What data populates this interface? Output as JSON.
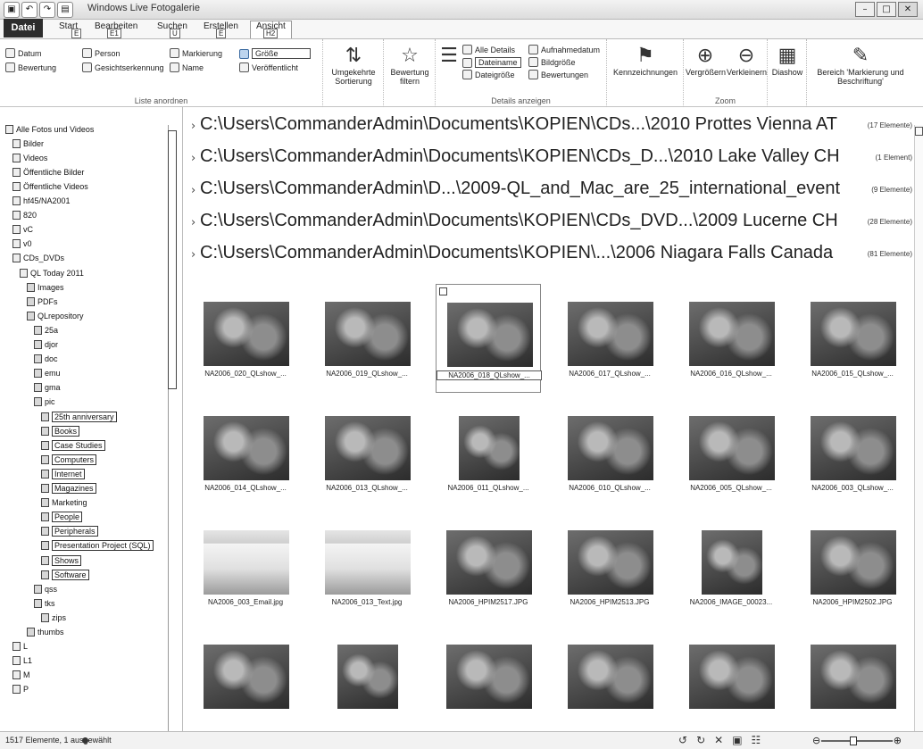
{
  "window": {
    "title": "Windows Live Fotogalerie"
  },
  "ribbon": {
    "app_menu": "Datei",
    "tabs": [
      {
        "label": "Start",
        "key": "E"
      },
      {
        "label": "Bearbeiten",
        "key": "E1"
      },
      {
        "label": "Suchen",
        "key": "U"
      },
      {
        "label": "Erstellen",
        "key": "E"
      },
      {
        "label": "Ansicht",
        "key": "H2"
      }
    ],
    "groups": {
      "list_arrange": {
        "label": "Liste anordnen",
        "items": [
          "Datum",
          "Bewertung",
          "Person",
          "Gesichtserkennung",
          "Markierung",
          "Name",
          "Größe",
          "Veröffentlicht"
        ]
      },
      "sort": {
        "label": "Umgekehrte Sortierung"
      },
      "rating": {
        "label": "Bewertung filtern"
      },
      "details": {
        "label": "Details anzeigen",
        "items": [
          "Alle Details",
          "Aufnahmedatum",
          "Dateiname",
          "Bildgröße",
          "Dateigröße",
          "Bewertungen"
        ]
      },
      "tags": {
        "label": "Kennzeichnungen"
      },
      "zoom": {
        "label": "Zoom",
        "items": [
          "Vergrößern",
          "Verkleinern"
        ]
      },
      "slideshow": {
        "label": "Diashow"
      },
      "view_toggle": {
        "label": "Bereich 'Markierung und Beschriftung'"
      }
    }
  },
  "sidebar": {
    "items": [
      {
        "label": "Alle Fotos und Videos",
        "indent": 0
      },
      {
        "label": "Bilder",
        "indent": 1
      },
      {
        "label": "Videos",
        "indent": 1
      },
      {
        "label": "Öffentliche Bilder",
        "indent": 1
      },
      {
        "label": "Öffentliche Videos",
        "indent": 1
      },
      {
        "label": "hf45/NA2001",
        "indent": 1
      },
      {
        "label": "820",
        "indent": 1
      },
      {
        "label": "vC",
        "indent": 1
      },
      {
        "label": "v0",
        "indent": 1
      },
      {
        "label": "CDs_DVDs",
        "indent": 1
      },
      {
        "label": "QL Today 2011",
        "indent": 2
      },
      {
        "label": "Images",
        "indent": 3
      },
      {
        "label": "PDFs",
        "indent": 3
      },
      {
        "label": "QLrepository",
        "indent": 3
      },
      {
        "label": "25a",
        "indent": 4
      },
      {
        "label": "djor",
        "indent": 4
      },
      {
        "label": "doc",
        "indent": 4
      },
      {
        "label": "emu",
        "indent": 4
      },
      {
        "label": "gma",
        "indent": 4
      },
      {
        "label": "pic",
        "indent": 4
      },
      {
        "label": "25th anniversary",
        "indent": 5,
        "boxed": true
      },
      {
        "label": "Books",
        "indent": 5,
        "boxed": true
      },
      {
        "label": "Case Studies",
        "indent": 5,
        "boxed": true
      },
      {
        "label": "Computers",
        "indent": 5,
        "boxed": true
      },
      {
        "label": "Internet",
        "indent": 5,
        "boxed": true
      },
      {
        "label": "Magazines",
        "indent": 5,
        "boxed": true
      },
      {
        "label": "Marketing",
        "indent": 5,
        "boxed": false
      },
      {
        "label": "People",
        "indent": 5,
        "boxed": true
      },
      {
        "label": "Peripherals",
        "indent": 5,
        "boxed": true
      },
      {
        "label": "Presentation Project (SQL)",
        "indent": 5,
        "boxed": true
      },
      {
        "label": "Shows",
        "indent": 5,
        "boxed": true
      },
      {
        "label": "Software",
        "indent": 5,
        "boxed": true
      },
      {
        "label": "qss",
        "indent": 4
      },
      {
        "label": "tks",
        "indent": 4
      },
      {
        "label": "zips",
        "indent": 5
      },
      {
        "label": "thumbs",
        "indent": 3
      },
      {
        "label": "L",
        "indent": 1
      },
      {
        "label": "L1",
        "indent": 1
      },
      {
        "label": "M",
        "indent": 1
      },
      {
        "label": "P",
        "indent": 1
      }
    ]
  },
  "groups": [
    {
      "path": "C:\\Users\\CommanderAdmin\\Documents\\KOPIEN\\CDs...\\2010 Prottes Vienna AT",
      "count": "(17 Elemente)"
    },
    {
      "path": "C:\\Users\\CommanderAdmin\\Documents\\KOPIEN\\CDs_D...\\2010 Lake Valley CH",
      "count": "(1 Element)"
    },
    {
      "path": "C:\\Users\\CommanderAdmin\\D...\\2009-QL_and_Mac_are_25_international_event",
      "count": "(9 Elemente)"
    },
    {
      "path": "C:\\Users\\CommanderAdmin\\Documents\\KOPIEN\\CDs_DVD...\\2009 Lucerne CH",
      "count": "(28 Elemente)"
    },
    {
      "path": "C:\\Users\\CommanderAdmin\\Documents\\KOPIEN\\...\\2006 Niagara Falls Canada",
      "count": "(81 Elemente)"
    }
  ],
  "thumbnails": [
    {
      "caption": "NA2006_020_QLshow_..."
    },
    {
      "caption": "NA2006_019_QLshow_..."
    },
    {
      "caption": "NA2006_018_QLshow_...",
      "selected": true
    },
    {
      "caption": "NA2006_017_QLshow_..."
    },
    {
      "caption": "NA2006_016_QLshow_..."
    },
    {
      "caption": "NA2006_015_QLshow_..."
    },
    {
      "caption": "NA2006_014_QLshow_..."
    },
    {
      "caption": "NA2006_013_QLshow_..."
    },
    {
      "caption": "NA2006_011_QLshow_..."
    },
    {
      "caption": "NA2006_010_QLshow_..."
    },
    {
      "caption": "NA2006_005_QLshow_..."
    },
    {
      "caption": "NA2006_003_QLshow_..."
    },
    {
      "caption": "NA2006_003_Email.jpg",
      "light": true
    },
    {
      "caption": "NA2006_013_Text.jpg",
      "light": true
    },
    {
      "caption": "NA2006_HPIM2517.JPG"
    },
    {
      "caption": "NA2006_HPIM2513.JPG"
    },
    {
      "caption": "NA2006_IMAGE_00023..."
    },
    {
      "caption": "NA2006_HPIM2502.JPG"
    },
    {
      "caption": ""
    },
    {
      "caption": ""
    },
    {
      "caption": ""
    },
    {
      "caption": ""
    },
    {
      "caption": ""
    },
    {
      "caption": ""
    }
  ],
  "status": {
    "text": "1517 Elemente, 1 ausgewählt"
  }
}
